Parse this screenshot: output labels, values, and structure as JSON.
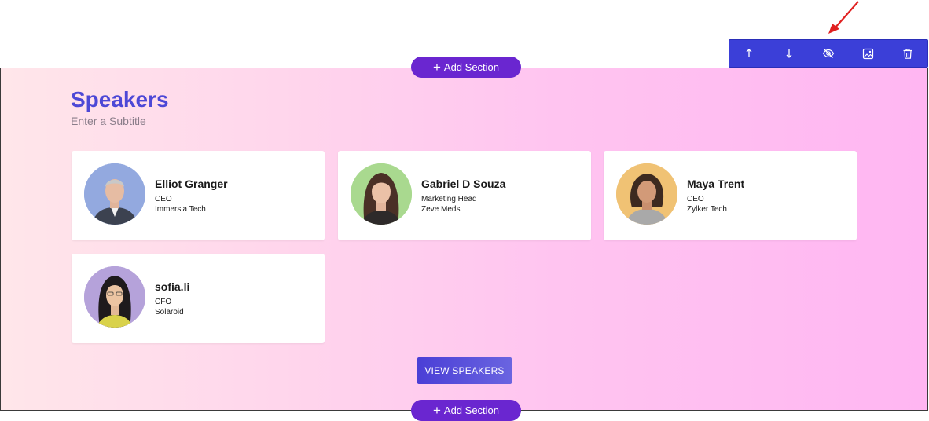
{
  "toolbar": {
    "tools": [
      {
        "icon": "arrow-up-icon",
        "action": "move up"
      },
      {
        "icon": "arrow-down-icon",
        "action": "move down"
      },
      {
        "icon": "eye-off-icon",
        "action": "hide"
      },
      {
        "icon": "image-icon",
        "action": "background image"
      },
      {
        "icon": "trash-icon",
        "action": "delete"
      }
    ],
    "background_color": "#3b3fd8"
  },
  "add_section_top": {
    "label": "Add Section"
  },
  "add_section_bottom": {
    "label": "Add Section"
  },
  "section": {
    "title": "Speakers",
    "subtitle": "Enter a Subtitle",
    "title_color": "#4d48d6"
  },
  "speakers": [
    {
      "name": "Elliot Granger",
      "role": "CEO",
      "company": "Immersia Tech",
      "avatar_bg": "#8fa8e0"
    },
    {
      "name": "Gabriel D Souza",
      "role": "Marketing Head",
      "company": "Zeve Meds",
      "avatar_bg": "#a8d890"
    },
    {
      "name": "Maya Trent",
      "role": "CEO",
      "company": "Zylker Tech",
      "avatar_bg": "#f0c070"
    },
    {
      "name": "sofia.li",
      "role": "CFO",
      "company": "Solaroid",
      "avatar_bg": "#b3a0d8"
    }
  ],
  "view_button": {
    "label": "VIEW SPEAKERS"
  },
  "annotation": {
    "arrow_color": "#e02020"
  }
}
